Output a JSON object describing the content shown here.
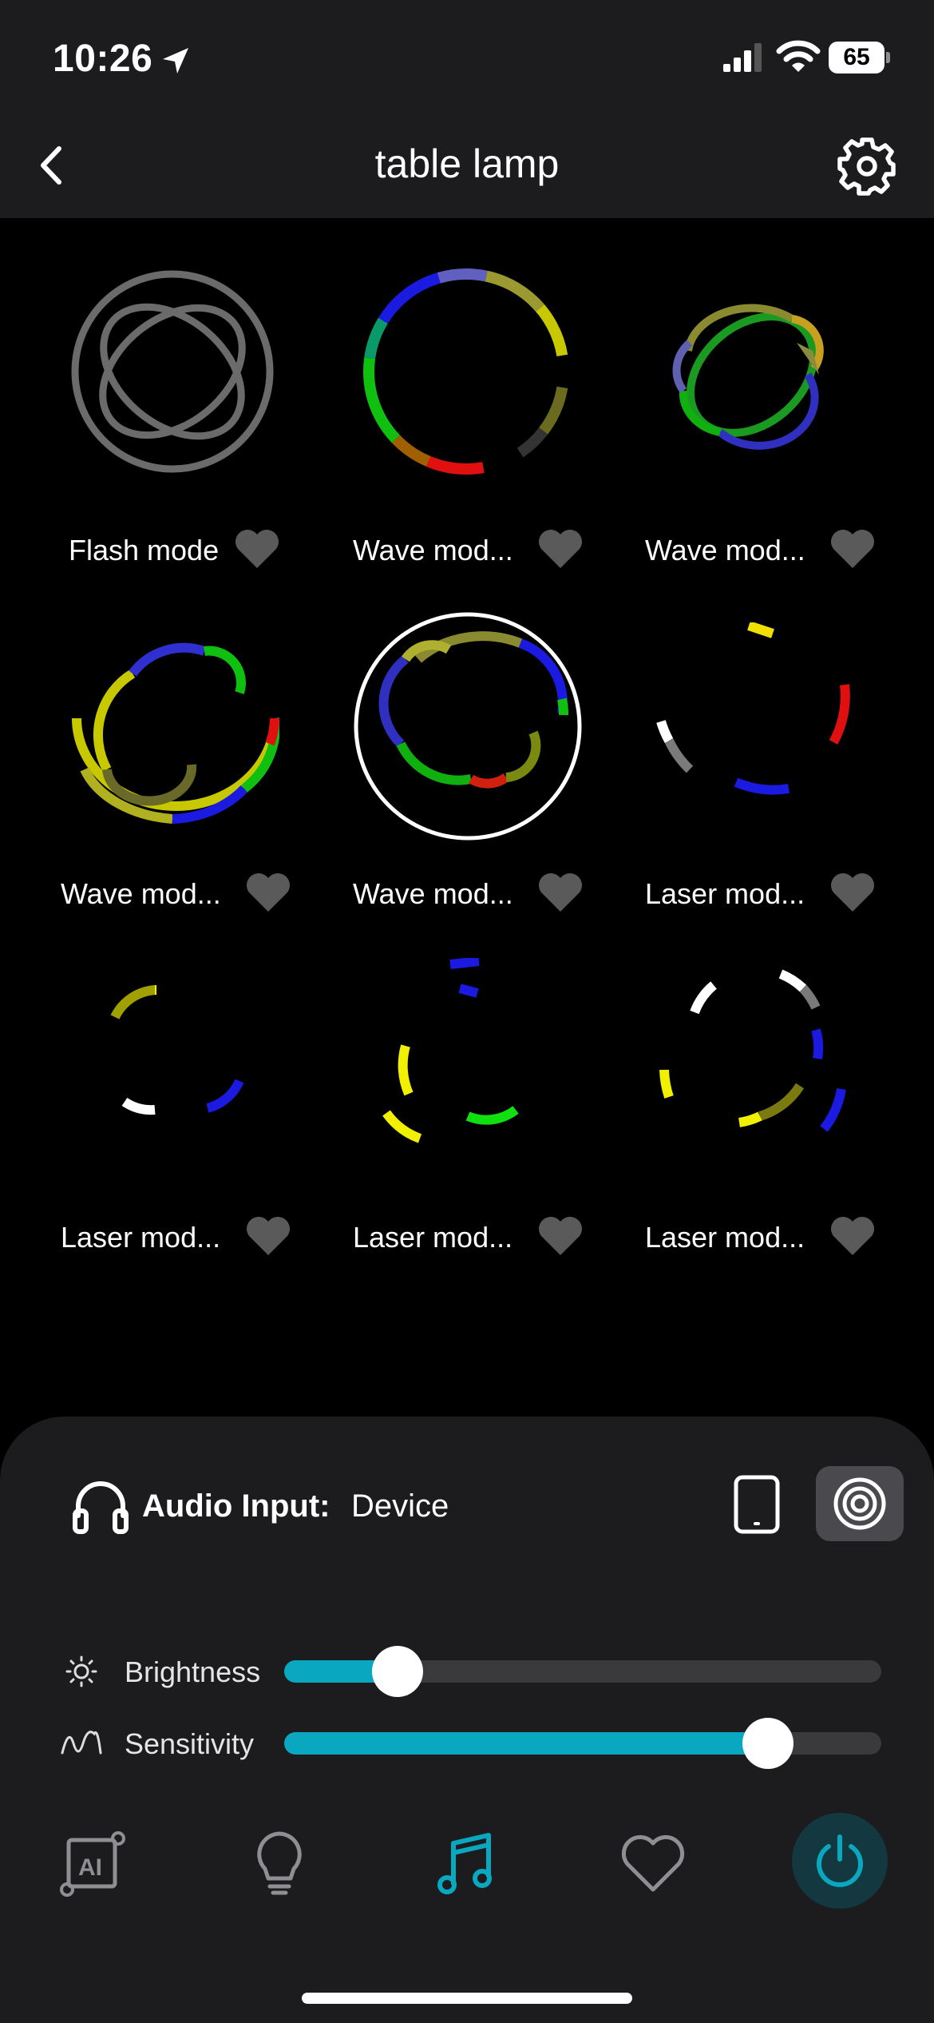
{
  "status": {
    "time": "10:26",
    "battery": "65"
  },
  "header": {
    "title": "table lamp"
  },
  "modes": [
    {
      "label": "Flash mode",
      "icon": "flash-mode-rings-icon"
    },
    {
      "label": "Wave mod...",
      "icon": "wave-ring-icon"
    },
    {
      "label": "Wave mod...",
      "icon": "wave-ellipse-icon"
    },
    {
      "label": "Wave mod...",
      "icon": "wave-spiral-icon"
    },
    {
      "label": "Wave mod...",
      "icon": "wave-spiral-selected-icon",
      "selected": true
    },
    {
      "label": "Laser mod...",
      "icon": "laser-arcs-icon"
    },
    {
      "label": "Laser mod...",
      "icon": "laser-arcs-icon"
    },
    {
      "label": "Laser mod...",
      "icon": "laser-arcs-icon"
    },
    {
      "label": "Laser mod...",
      "icon": "laser-arcs-icon"
    }
  ],
  "audio": {
    "label": "Audio Input:",
    "value": "Device",
    "active_source": "microphone"
  },
  "sliders": {
    "brightness": {
      "label": "Brightness",
      "value": 0.19
    },
    "sensitivity": {
      "label": "Sensitivity",
      "value": 0.81
    }
  },
  "tabs": [
    "ai",
    "light",
    "music",
    "favorites",
    "power"
  ],
  "active_tab": "music",
  "colors": {
    "accent": "#0aa7c0",
    "background": "#000000",
    "surface": "#1c1c1e"
  }
}
